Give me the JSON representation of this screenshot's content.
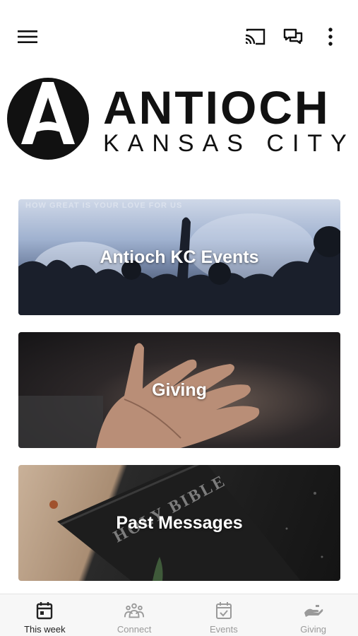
{
  "topbar": {
    "menu_icon": "hamburger-menu-icon",
    "actions": [
      "cast-icon",
      "chat-icon",
      "more-vertical-icon"
    ]
  },
  "logo": {
    "title": "ANTIOCH",
    "subtitle": "KANSAS CITY"
  },
  "cards": [
    {
      "title": "Antioch KC Events",
      "banner_text": "HOW GREAT IS YOUR LOVE FOR US"
    },
    {
      "title": "Giving"
    },
    {
      "title": "Past Messages",
      "bible_text": "HOLY BIBLE"
    }
  ],
  "bottom_nav": {
    "active_index": 0,
    "items": [
      {
        "label": "This week",
        "icon": "calendar-icon"
      },
      {
        "label": "Connect",
        "icon": "people-group-icon"
      },
      {
        "label": "Events",
        "icon": "calendar-check-icon"
      },
      {
        "label": "Giving",
        "icon": "giving-hand-icon"
      }
    ]
  },
  "colors": {
    "text": "#111111",
    "nav_inactive": "#9a9a9a",
    "nav_bg": "#f7f7f7"
  }
}
